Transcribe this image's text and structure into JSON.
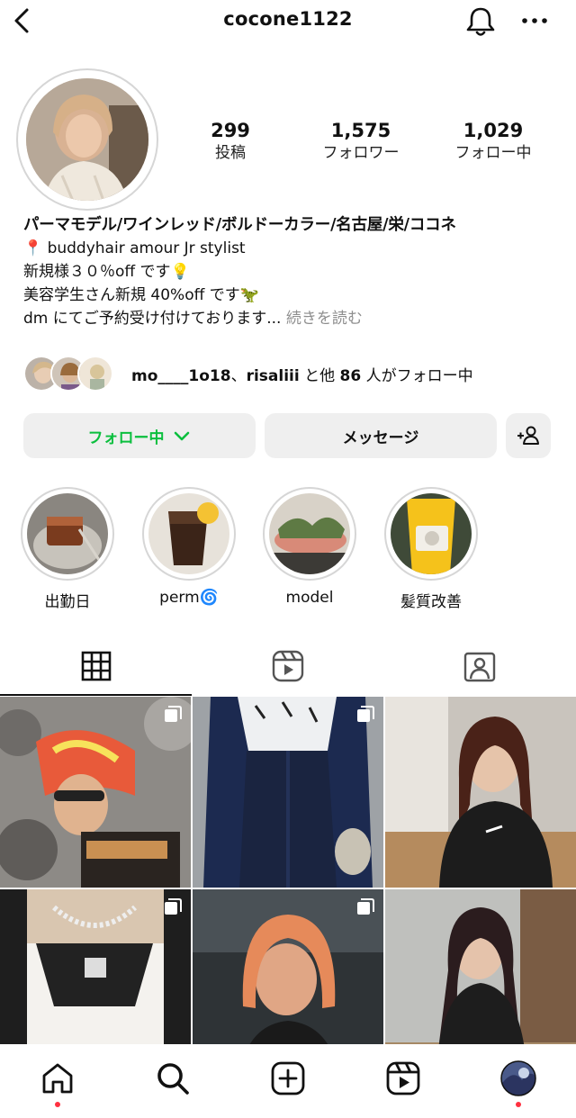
{
  "header": {
    "username": "cocone1122",
    "back_icon": "chevron-left-icon",
    "notification_icon": "bell-icon",
    "more_icon": "more-horizontal-icon"
  },
  "stats": [
    {
      "value": "299",
      "label": "投稿"
    },
    {
      "value": "1,575",
      "label": "フォロワー"
    },
    {
      "value": "1,029",
      "label": "フォロー中"
    }
  ],
  "bio": {
    "name": "パーマモデル/ワインレッド/ボルドーカラー/名古屋/栄/ココネ",
    "lines": [
      "📍 buddyhair amour Jr stylist",
      "新規様３０％off です💡",
      "美容学生さん新規 40%off です🦖",
      "dm にてご予約受け付けております..."
    ],
    "more_link": "続きを読む"
  },
  "followed_by": {
    "user1": "mo____1o18",
    "sep": "、",
    "user2": "risaliii",
    "mid": " と他 ",
    "count": "86",
    "suffix": " 人がフォロー中"
  },
  "actions": {
    "follow_label": "フォロー中",
    "message_label": "メッセージ",
    "add_user_icon": "add-person-icon",
    "accent": "#0bbf3e"
  },
  "highlights": [
    {
      "label": "出勤日"
    },
    {
      "label": "perm🌀"
    },
    {
      "label": "model"
    },
    {
      "label": "髪質改善"
    }
  ],
  "tabs": [
    {
      "icon": "grid-icon",
      "selected": true
    },
    {
      "icon": "reels-icon",
      "selected": false
    },
    {
      "icon": "tagged-icon",
      "selected": false
    }
  ],
  "bottom_nav": [
    {
      "icon": "home-icon"
    },
    {
      "icon": "search-icon"
    },
    {
      "icon": "create-icon"
    },
    {
      "icon": "reels-icon"
    },
    {
      "icon": "profile-avatar"
    }
  ],
  "colors": {
    "notification_dot": "#ff3040",
    "muted": "#8e8e8e"
  }
}
